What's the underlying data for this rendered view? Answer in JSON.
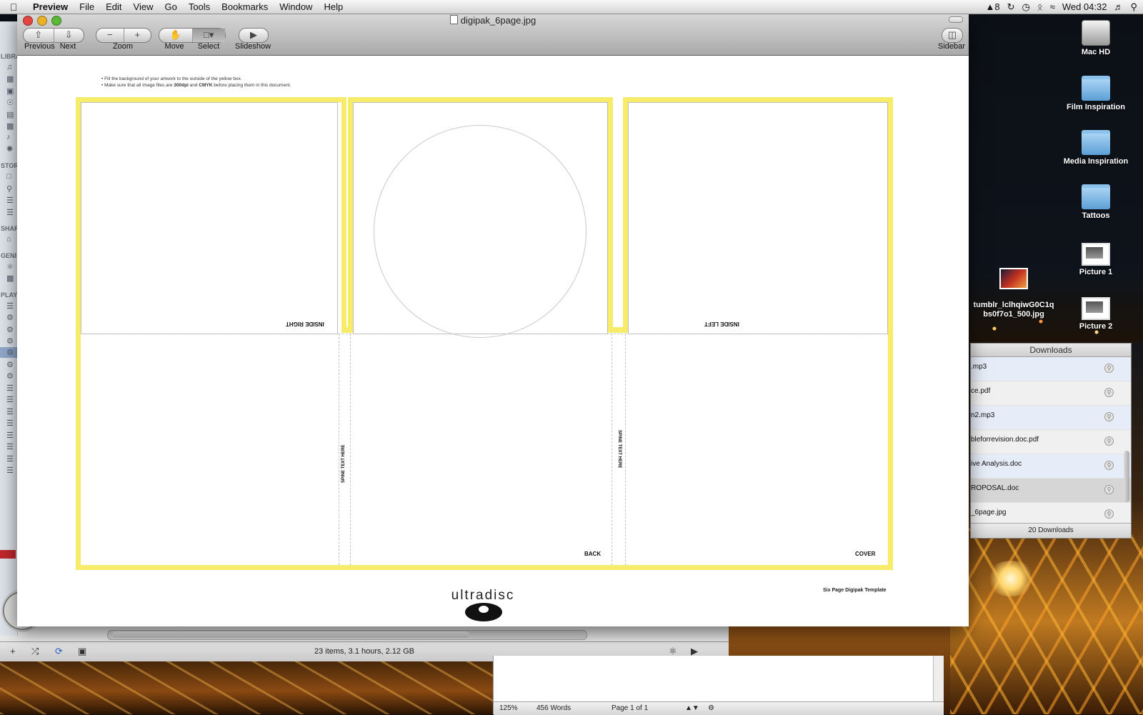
{
  "menubar": {
    "app": "Preview",
    "items": [
      "File",
      "Edit",
      "View",
      "Go",
      "Tools",
      "Bookmarks",
      "Window",
      "Help"
    ],
    "status_adobe": "8",
    "clock": "Wed 04:32"
  },
  "preview": {
    "title": "digipak_6page.jpg",
    "toolbar": {
      "previous": "Previous",
      "next": "Next",
      "zoom": "Zoom",
      "move": "Move",
      "select": "Select",
      "slideshow": "Slideshow",
      "sidebar": "Sidebar"
    },
    "template": {
      "note1": "• Fill the background of your artwork to the outside of the yellow box.",
      "note2_a": "• Make sure that all image files are ",
      "note2_b": "300dpi",
      "note2_c": " and ",
      "note2_d": "CMYK",
      "note2_e": " before placing them in this document.",
      "inside_right": "INSIDE RIGHT",
      "inside_left": "INSIDE LEFT",
      "spine_left": "SPINE TEXT HERE",
      "spine_right": "SPINE TEXT HERE",
      "back": "BACK",
      "cover": "COVER",
      "brand": "ultradisc",
      "template_name": "Six Page Digipak Template",
      "border_color": "#f6ec6a"
    }
  },
  "desktop_icons": [
    {
      "label": "Mac HD",
      "icon": "hard-drive-icon"
    },
    {
      "label": "Film Inspiration",
      "icon": "folder-icon"
    },
    {
      "label": "Media Inspiration",
      "icon": "folder-icon"
    },
    {
      "label": "Tattoos",
      "icon": "folder-icon"
    },
    {
      "label": "Picture 1",
      "icon": "picture-icon"
    },
    {
      "label": "Picture 2",
      "icon": "picture-icon"
    },
    {
      "label": "tumblr_lclhqiwG0C1q\nbs0f7o1_500.jpg",
      "icon": "image-thumb-icon"
    }
  ],
  "downloads": {
    "title": "Downloads",
    "items": [
      ".mp3",
      "ce.pdf",
      "n2.mp3",
      "bleforrevision.doc.pdf",
      "ive Analysis.doc",
      "ROPOSAL.doc",
      "_6page.jpg"
    ],
    "footer": "20 Downloads"
  },
  "itunes": {
    "status": "23 items, 3.1 hours, 2.12 GB",
    "sidebar_sections": [
      "LIBRA",
      "STOR",
      "SHAR",
      "GENI",
      "PLAY"
    ]
  },
  "textedit": {
    "zoom": "125%",
    "words": "456 Words",
    "page": "Page 1 of 1"
  }
}
